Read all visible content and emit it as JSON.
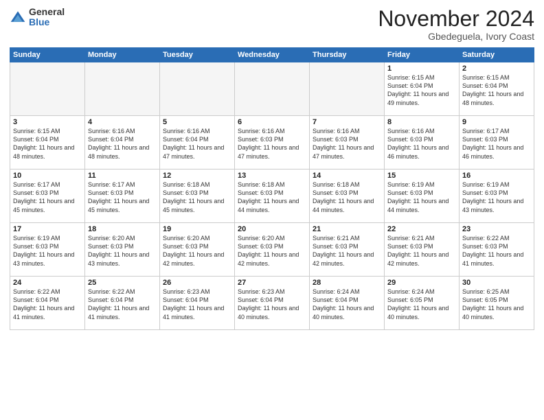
{
  "header": {
    "logo_general": "General",
    "logo_blue": "Blue",
    "month_title": "November 2024",
    "location": "Gbedeguela, Ivory Coast"
  },
  "weekdays": [
    "Sunday",
    "Monday",
    "Tuesday",
    "Wednesday",
    "Thursday",
    "Friday",
    "Saturday"
  ],
  "weeks": [
    [
      {
        "day": "",
        "info": ""
      },
      {
        "day": "",
        "info": ""
      },
      {
        "day": "",
        "info": ""
      },
      {
        "day": "",
        "info": ""
      },
      {
        "day": "",
        "info": ""
      },
      {
        "day": "1",
        "info": "Sunrise: 6:15 AM\nSunset: 6:04 PM\nDaylight: 11 hours\nand 49 minutes."
      },
      {
        "day": "2",
        "info": "Sunrise: 6:15 AM\nSunset: 6:04 PM\nDaylight: 11 hours\nand 48 minutes."
      }
    ],
    [
      {
        "day": "3",
        "info": "Sunrise: 6:15 AM\nSunset: 6:04 PM\nDaylight: 11 hours\nand 48 minutes."
      },
      {
        "day": "4",
        "info": "Sunrise: 6:16 AM\nSunset: 6:04 PM\nDaylight: 11 hours\nand 48 minutes."
      },
      {
        "day": "5",
        "info": "Sunrise: 6:16 AM\nSunset: 6:04 PM\nDaylight: 11 hours\nand 47 minutes."
      },
      {
        "day": "6",
        "info": "Sunrise: 6:16 AM\nSunset: 6:03 PM\nDaylight: 11 hours\nand 47 minutes."
      },
      {
        "day": "7",
        "info": "Sunrise: 6:16 AM\nSunset: 6:03 PM\nDaylight: 11 hours\nand 47 minutes."
      },
      {
        "day": "8",
        "info": "Sunrise: 6:16 AM\nSunset: 6:03 PM\nDaylight: 11 hours\nand 46 minutes."
      },
      {
        "day": "9",
        "info": "Sunrise: 6:17 AM\nSunset: 6:03 PM\nDaylight: 11 hours\nand 46 minutes."
      }
    ],
    [
      {
        "day": "10",
        "info": "Sunrise: 6:17 AM\nSunset: 6:03 PM\nDaylight: 11 hours\nand 45 minutes."
      },
      {
        "day": "11",
        "info": "Sunrise: 6:17 AM\nSunset: 6:03 PM\nDaylight: 11 hours\nand 45 minutes."
      },
      {
        "day": "12",
        "info": "Sunrise: 6:18 AM\nSunset: 6:03 PM\nDaylight: 11 hours\nand 45 minutes."
      },
      {
        "day": "13",
        "info": "Sunrise: 6:18 AM\nSunset: 6:03 PM\nDaylight: 11 hours\nand 44 minutes."
      },
      {
        "day": "14",
        "info": "Sunrise: 6:18 AM\nSunset: 6:03 PM\nDaylight: 11 hours\nand 44 minutes."
      },
      {
        "day": "15",
        "info": "Sunrise: 6:19 AM\nSunset: 6:03 PM\nDaylight: 11 hours\nand 44 minutes."
      },
      {
        "day": "16",
        "info": "Sunrise: 6:19 AM\nSunset: 6:03 PM\nDaylight: 11 hours\nand 43 minutes."
      }
    ],
    [
      {
        "day": "17",
        "info": "Sunrise: 6:19 AM\nSunset: 6:03 PM\nDaylight: 11 hours\nand 43 minutes."
      },
      {
        "day": "18",
        "info": "Sunrise: 6:20 AM\nSunset: 6:03 PM\nDaylight: 11 hours\nand 43 minutes."
      },
      {
        "day": "19",
        "info": "Sunrise: 6:20 AM\nSunset: 6:03 PM\nDaylight: 11 hours\nand 42 minutes."
      },
      {
        "day": "20",
        "info": "Sunrise: 6:20 AM\nSunset: 6:03 PM\nDaylight: 11 hours\nand 42 minutes."
      },
      {
        "day": "21",
        "info": "Sunrise: 6:21 AM\nSunset: 6:03 PM\nDaylight: 11 hours\nand 42 minutes."
      },
      {
        "day": "22",
        "info": "Sunrise: 6:21 AM\nSunset: 6:03 PM\nDaylight: 11 hours\nand 42 minutes."
      },
      {
        "day": "23",
        "info": "Sunrise: 6:22 AM\nSunset: 6:03 PM\nDaylight: 11 hours\nand 41 minutes."
      }
    ],
    [
      {
        "day": "24",
        "info": "Sunrise: 6:22 AM\nSunset: 6:04 PM\nDaylight: 11 hours\nand 41 minutes."
      },
      {
        "day": "25",
        "info": "Sunrise: 6:22 AM\nSunset: 6:04 PM\nDaylight: 11 hours\nand 41 minutes."
      },
      {
        "day": "26",
        "info": "Sunrise: 6:23 AM\nSunset: 6:04 PM\nDaylight: 11 hours\nand 41 minutes."
      },
      {
        "day": "27",
        "info": "Sunrise: 6:23 AM\nSunset: 6:04 PM\nDaylight: 11 hours\nand 40 minutes."
      },
      {
        "day": "28",
        "info": "Sunrise: 6:24 AM\nSunset: 6:04 PM\nDaylight: 11 hours\nand 40 minutes."
      },
      {
        "day": "29",
        "info": "Sunrise: 6:24 AM\nSunset: 6:05 PM\nDaylight: 11 hours\nand 40 minutes."
      },
      {
        "day": "30",
        "info": "Sunrise: 6:25 AM\nSunset: 6:05 PM\nDaylight: 11 hours\nand 40 minutes."
      }
    ]
  ]
}
